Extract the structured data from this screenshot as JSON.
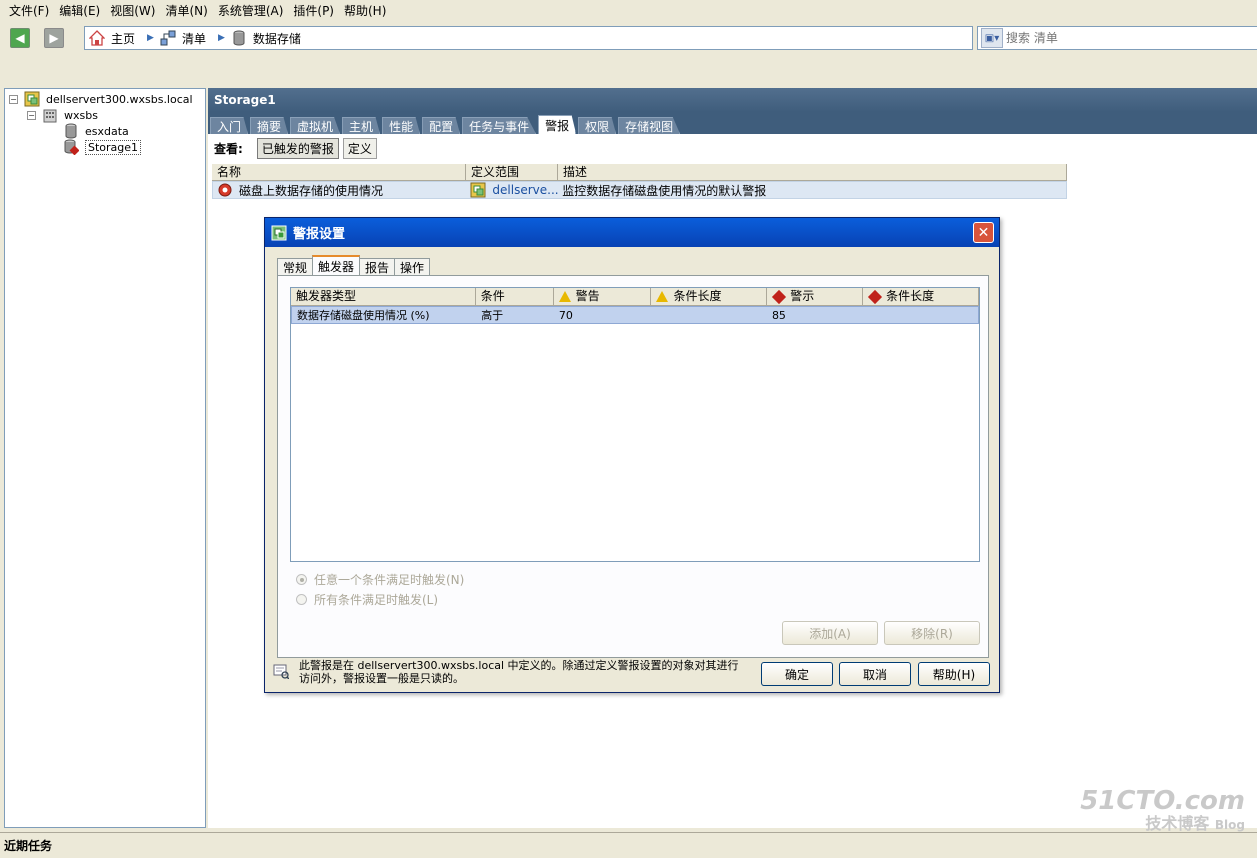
{
  "menu": [
    "文件(F)",
    "编辑(E)",
    "视图(W)",
    "清单(N)",
    "系统管理(A)",
    "插件(P)",
    "帮助(H)"
  ],
  "breadcrumb": {
    "home": "主页",
    "inventory": "清单",
    "datastores": "数据存储"
  },
  "search": {
    "placeholder": "搜索 清单"
  },
  "tree": {
    "server": "dellservert300.wxsbs.local",
    "datacenter": "wxsbs",
    "store1": "esxdata",
    "store2": "Storage1"
  },
  "panel": {
    "title": "Storage1",
    "tabs": [
      "入门",
      "摘要",
      "虚拟机",
      "主机",
      "性能",
      "配置",
      "任务与事件",
      "警报",
      "权限",
      "存储视图"
    ],
    "active_tab": "警报"
  },
  "view": {
    "label": "查看:",
    "triggered": "已触发的警报",
    "definitions": "定义"
  },
  "alarm_table": {
    "headers": [
      "名称",
      "定义范围",
      "描述"
    ],
    "row": {
      "name": "磁盘上数据存储的使用情况",
      "scope": "dellserve...",
      "description": "监控数据存储磁盘使用情况的默认警报"
    }
  },
  "dialog": {
    "title": "警报设置",
    "tabs": [
      "常规",
      "触发器",
      "报告",
      "操作"
    ],
    "active_tab": "触发器",
    "grid_headers": [
      "触发器类型",
      "条件",
      "警告",
      "条件长度",
      "警示",
      "条件长度"
    ],
    "grid_row": {
      "type": "数据存储磁盘使用情况 (%)",
      "condition": "高于",
      "warning": "70",
      "warning_len": "",
      "alert": "85",
      "alert_len": ""
    },
    "radio_any": "任意一个条件满足时触发(N)",
    "radio_all": "所有条件满足时触发(L)",
    "add": "添加(A)",
    "remove": "移除(R)",
    "info": "此警报是在 dellservert300.wxsbs.local 中定义的。除通过定义警报设置的对象对其进行访问外，警报设置一般是只读的。",
    "ok": "确定",
    "cancel": "取消",
    "help": "帮助(H)"
  },
  "recent_tasks": "近期任务",
  "watermark": {
    "line1": "51CTO.com",
    "line2": "技术博客",
    "line3": "Blog"
  },
  "colors": {
    "title_blue": "#0a5edb",
    "panel_header": "#3f5d7c",
    "selection": "#c1d2ee",
    "alert_red": "#c0221a",
    "warning_yellow": "#e8b800"
  }
}
